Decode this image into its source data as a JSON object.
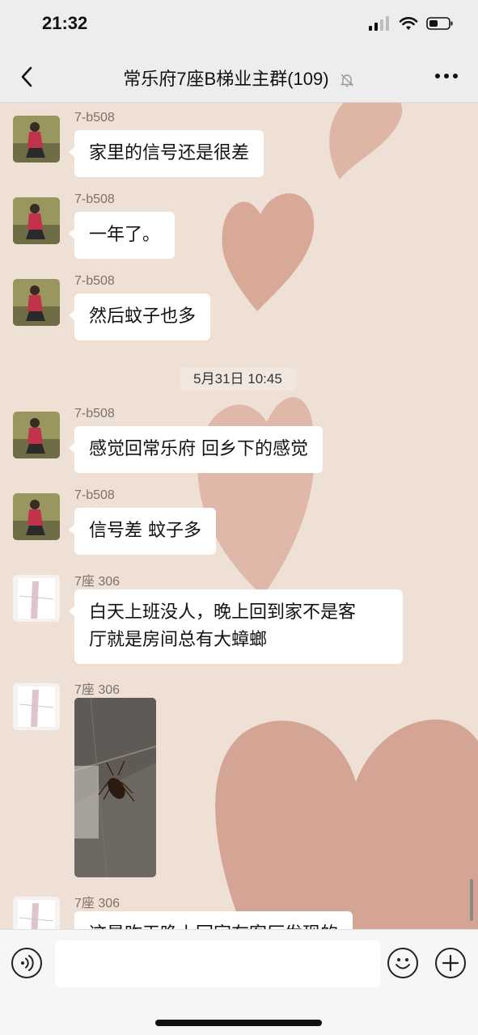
{
  "status": {
    "time": "21:32"
  },
  "header": {
    "title": "常乐府7座B梯业主群(109)"
  },
  "messages": [
    {
      "sender": "7-b508",
      "text": "家里的信号还是很差"
    },
    {
      "sender": "7-b508",
      "text": "一年了。"
    },
    {
      "sender": "7-b508",
      "text": "然后蚊子也多"
    },
    {
      "time_separator": "5月31日 10:45"
    },
    {
      "sender": "7-b508",
      "text": "感觉回常乐府 回乡下的感觉"
    },
    {
      "sender": "7-b508",
      "text": "信号差 蚊子多"
    },
    {
      "sender": "7座 306",
      "text_lines": [
        "白天上班没人，晚上回到家不是客",
        "厅就是房间总有大蟑螂"
      ]
    },
    {
      "sender": "7座 306",
      "image": "cockroach-photo"
    },
    {
      "sender": "7座 306",
      "text": "这是昨天晚上回家在客厅发现的"
    }
  ],
  "colors": {
    "chat_bg": "#efe0d6",
    "heart": "#d49e8c",
    "bubble": "#ffffff"
  },
  "icons": [
    "back-arrow-icon",
    "mute-bell-icon",
    "more-dots-icon",
    "voice-icon",
    "emoji-icon",
    "plus-icon"
  ]
}
